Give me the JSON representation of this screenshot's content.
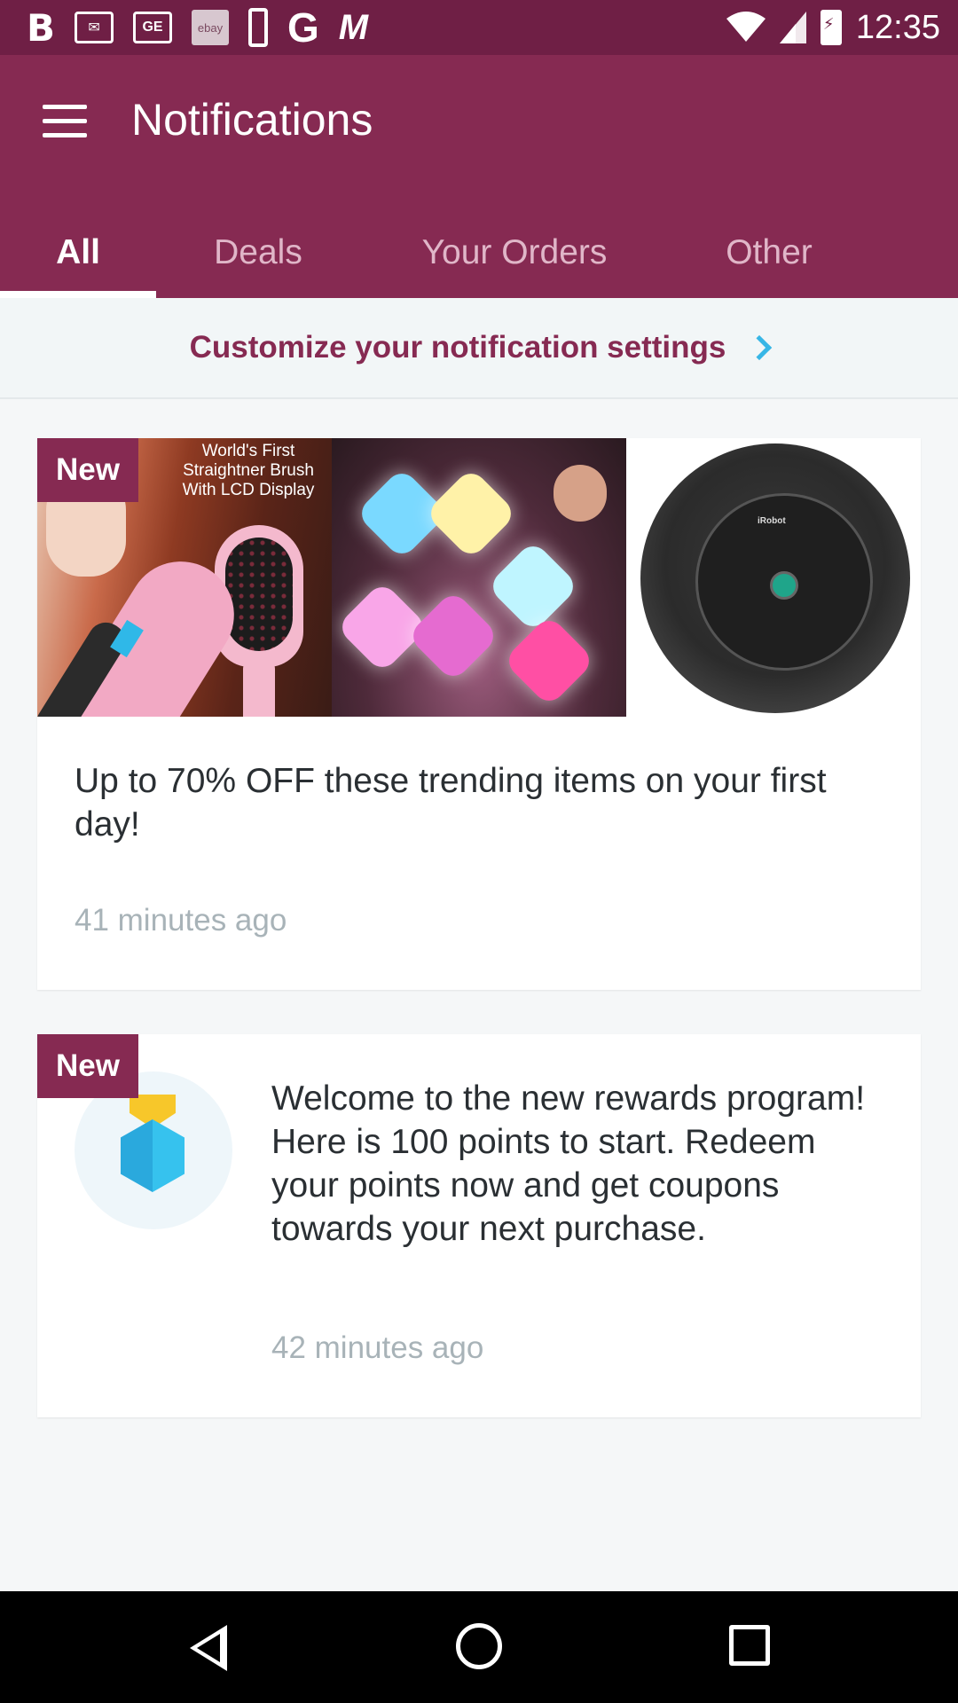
{
  "status_bar": {
    "time": "12:35",
    "notification_icons": [
      "b-icon",
      "gmail-icon",
      "ge-icon",
      "ebay-icon",
      "phone-icon",
      "google-icon",
      "m-icon"
    ],
    "ge_text": "GE",
    "ebay_text": "ebay",
    "g_text": "G",
    "b_text": "B",
    "m_text": "M"
  },
  "header": {
    "title": "Notifications",
    "bar_color": "#862a52"
  },
  "tabs": [
    {
      "label": "All",
      "active": true
    },
    {
      "label": "Deals",
      "active": false
    },
    {
      "label": "Your Orders",
      "active": false
    },
    {
      "label": "Other",
      "active": false
    }
  ],
  "customize": {
    "label": "Customize your notification settings"
  },
  "notifications": [
    {
      "badge": "New",
      "promo_text": "World's First Straightner Brush With LCD Display",
      "robot_label": "iRobot",
      "title": "Up to 70% OFF these trending items on your first day!",
      "time": "41 minutes ago"
    },
    {
      "badge": "New",
      "title": "Welcome to the new rewards program! Here is 100 points to start. Redeem your points now and get coupons towards your next purchase.",
      "time": "42 minutes ago"
    }
  ],
  "colors": {
    "accent": "#862a52",
    "status_bar": "#6f1f45",
    "chevron": "#37b6e6",
    "timestamp": "#a8b3b8"
  }
}
